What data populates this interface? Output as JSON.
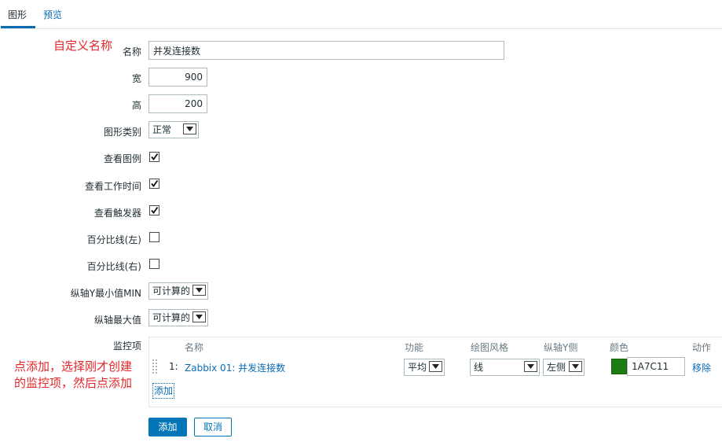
{
  "tabs": [
    {
      "label": "图形",
      "active": true
    },
    {
      "label": "预览",
      "active": false
    }
  ],
  "form": {
    "name_label": "名称",
    "name_value": "并发连接数",
    "width_label": "宽",
    "width_value": "900",
    "height_label": "高",
    "height_value": "200",
    "graph_type_label": "图形类别",
    "graph_type_value": "正常",
    "show_legend_label": "查看图例",
    "show_legend_checked": true,
    "show_worktime_label": "查看工作时间",
    "show_worktime_checked": true,
    "show_triggers_label": "查看触发器",
    "show_triggers_checked": true,
    "percentile_left_label": "百分比线(左)",
    "percentile_left_checked": false,
    "percentile_right_label": "百分比线(右)",
    "percentile_right_checked": false,
    "y_min_label": "纵轴Y最小值MIN",
    "y_min_value": "可计算的",
    "y_max_label": "纵轴最大值",
    "y_max_value": "可计算的",
    "items_label": "监控项"
  },
  "items_table": {
    "headers": {
      "name": "名称",
      "function": "功能",
      "draw_style": "绘图风格",
      "y_axis_side": "纵轴Y侧",
      "color": "颜色",
      "action": "动作"
    },
    "rows": [
      {
        "index": "1:",
        "name": "Zabbix 01: 并发连接数",
        "function": "平均",
        "draw_style": "线",
        "y_axis_side": "左侧",
        "color_hex": "#1A7C11",
        "color_value": "1A7C11",
        "remove_label": "移除"
      }
    ],
    "add_label": "添加"
  },
  "buttons": {
    "add": "添加",
    "cancel": "取消"
  },
  "annotations": {
    "custom_name": "自定义名称",
    "items_line1": "点添加，选择刚才创建",
    "items_line2": "的监控项，然后点添加"
  },
  "colors": {
    "accent": "#0275b8",
    "link": "#0a6cb5",
    "annotation": "#e3262a"
  }
}
